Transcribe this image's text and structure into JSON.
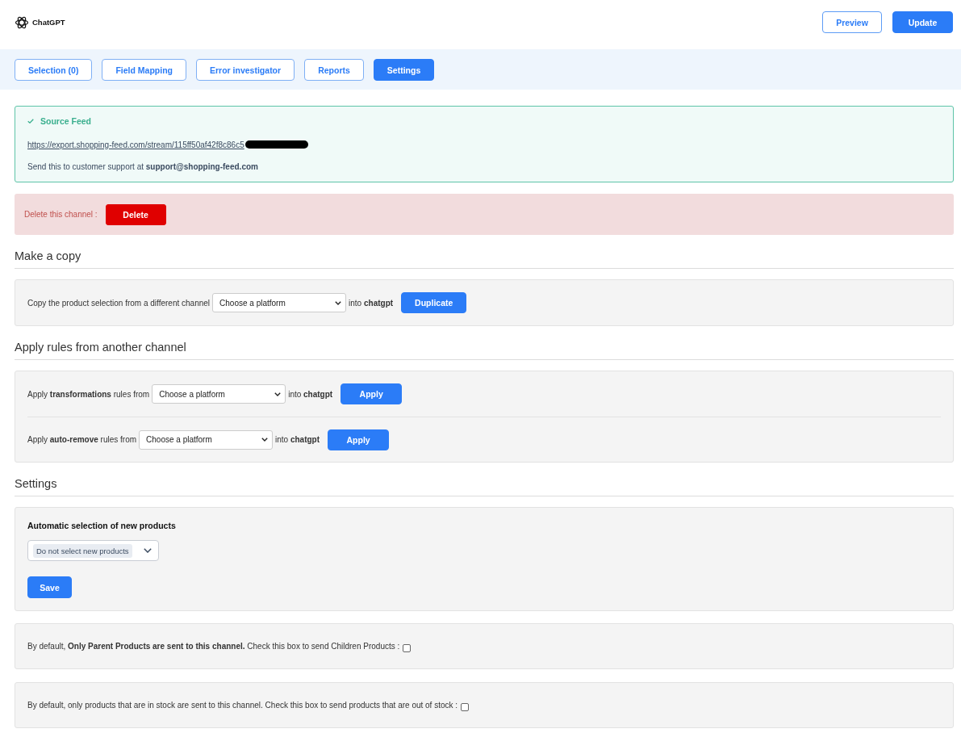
{
  "header": {
    "logo_text": "ChatGPT",
    "buttons": [
      {
        "label": "Preview",
        "kind": "outline"
      },
      {
        "label": "Update",
        "kind": "primary"
      }
    ]
  },
  "tabs": [
    {
      "label": "Selection (0)",
      "selected": false
    },
    {
      "label": "Field Mapping",
      "selected": false
    },
    {
      "label": "Error investigator",
      "selected": false
    },
    {
      "label": "Reports",
      "selected": false
    },
    {
      "label": "Settings",
      "selected": true
    }
  ],
  "source_feed": {
    "title": "Source Feed",
    "url": "https://export.shopping-feed.com/stream/115ff50af42f8c86c5",
    "redacted": true,
    "note": "Send this to customer support at **support@shopping-feed.com**"
  },
  "delete_channel": {
    "label": "Delete this channel :",
    "button": "Delete"
  },
  "sections": [
    {
      "heading": "Make a copy",
      "rows": [
        {
          "text": "Copy the product selection from a different channel",
          "select": "Choose a platform",
          "target": "into **chatgpt**",
          "button": "Duplicate"
        }
      ]
    },
    {
      "heading": "Apply rules from another channel",
      "rows": [
        {
          "text": "Apply **transformations** rules from",
          "select": "Choose a platform",
          "target": "into **chatgpt**",
          "button": "Apply"
        },
        {
          "text": "Apply **auto-remove** rules from",
          "select": "Choose a platform",
          "target": "into **chatgpt**",
          "button": "Apply"
        }
      ]
    }
  ],
  "settings": {
    "heading": "Settings",
    "auto_selection": {
      "label": "Automatic selection of new products",
      "value": "Do not select new products",
      "button": "Save"
    },
    "options": [
      {
        "text": "By default, **Only Parent Products are sent to this channel.** Check this box to send Children Products :",
        "checked": false
      },
      {
        "text": "By default, only products that are in stock are sent to this channel. Check this box to send products that are out of stock :",
        "checked": false
      }
    ]
  }
}
